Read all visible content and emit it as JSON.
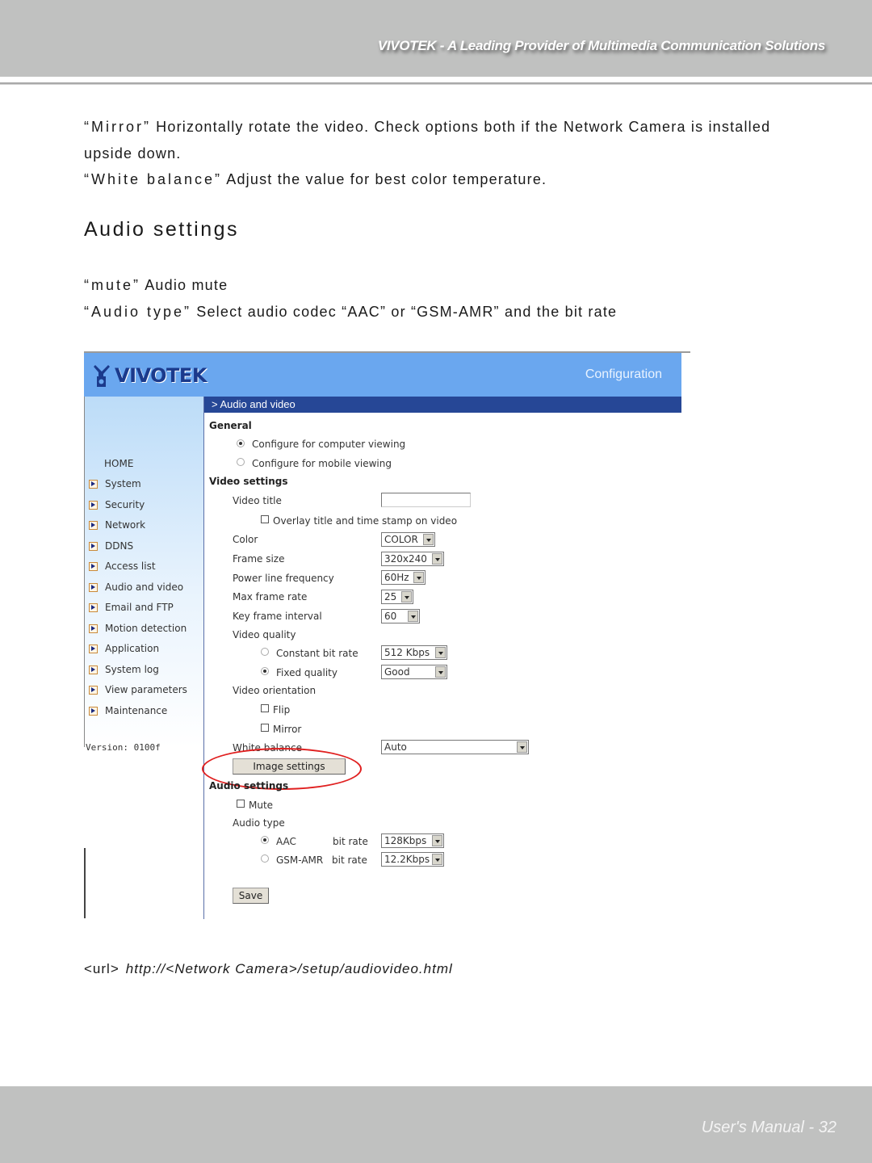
{
  "header": {
    "tagline": "VIVOTEK - A Leading Provider of Multimedia Communication Solutions"
  },
  "intro": {
    "mirror_term": "“Mirror”",
    "mirror_desc": " Horizontally rotate the video. Check options both if the Network Camera is installed upside down.",
    "wb_term": "“White balance”",
    "wb_desc": " Adjust the value for best color temperature."
  },
  "section": {
    "heading": "Audio settings",
    "mute_term": "“mute”",
    "mute_desc": " Audio mute",
    "audiotype_term": "“Audio type”",
    "audiotype_desc": " Select audio codec “AAC” or “GSM-AMR” and the bit rate"
  },
  "screenshot": {
    "logo_text": "VIVOTEK",
    "config_label": "Configuration",
    "breadcrumb": "> Audio and video",
    "sidebar": {
      "home": "HOME",
      "items": [
        "System",
        "Security",
        "Network",
        "DDNS",
        "Access list",
        "Audio and video",
        "Email and FTP",
        "Motion detection",
        "Application",
        "System log",
        "View parameters",
        "Maintenance"
      ],
      "version": "Version: 0100f"
    },
    "general": {
      "title": "General",
      "option_computer": "Configure for computer viewing",
      "option_mobile": "Configure for mobile viewing",
      "selected": "computer"
    },
    "video": {
      "title": "Video settings",
      "video_title_label": "Video title",
      "video_title_value": "",
      "overlay_label": "Overlay title and time stamp on video",
      "overlay_checked": false,
      "color_label": "Color",
      "color_value": "COLOR",
      "frame_size_label": "Frame size",
      "frame_size_value": "320x240",
      "power_line_label": "Power line frequency",
      "power_line_value": "60Hz",
      "max_frame_rate_label": "Max frame rate",
      "max_frame_rate_value": "25",
      "key_frame_label": "Key frame interval",
      "key_frame_value": "60",
      "quality_label": "Video quality",
      "cbr_label": "Constant bit rate",
      "cbr_value": "512 Kbps",
      "fixed_label": "Fixed quality",
      "fixed_value": "Good",
      "quality_selected": "fixed",
      "orientation_label": "Video orientation",
      "flip_label": "Flip",
      "mirror_label": "Mirror",
      "white_balance_label": "White balance",
      "white_balance_value": "Auto",
      "image_settings_button": "Image settings"
    },
    "audio": {
      "title": "Audio settings",
      "mute_label": "Mute",
      "type_label": "Audio type",
      "aac_label": "AAC",
      "aac_bitrate_label": "bit rate",
      "aac_bitrate_value": "128Kbps",
      "gsm_label": "GSM-AMR",
      "gsm_bitrate_label": "bit rate",
      "gsm_bitrate_value": "12.2Kbps",
      "selected": "AAC",
      "save_button": "Save"
    }
  },
  "url": {
    "label": "<url>",
    "value": "http://<Network Camera>/setup/audiovideo.html"
  },
  "footer": {
    "page_label": "User's Manual - 32"
  },
  "colors": {
    "banner": "#6aa7ef",
    "breadcrumb_bar": "#264796",
    "highlight": "#e02020",
    "page_band": "#c0c1c0"
  }
}
